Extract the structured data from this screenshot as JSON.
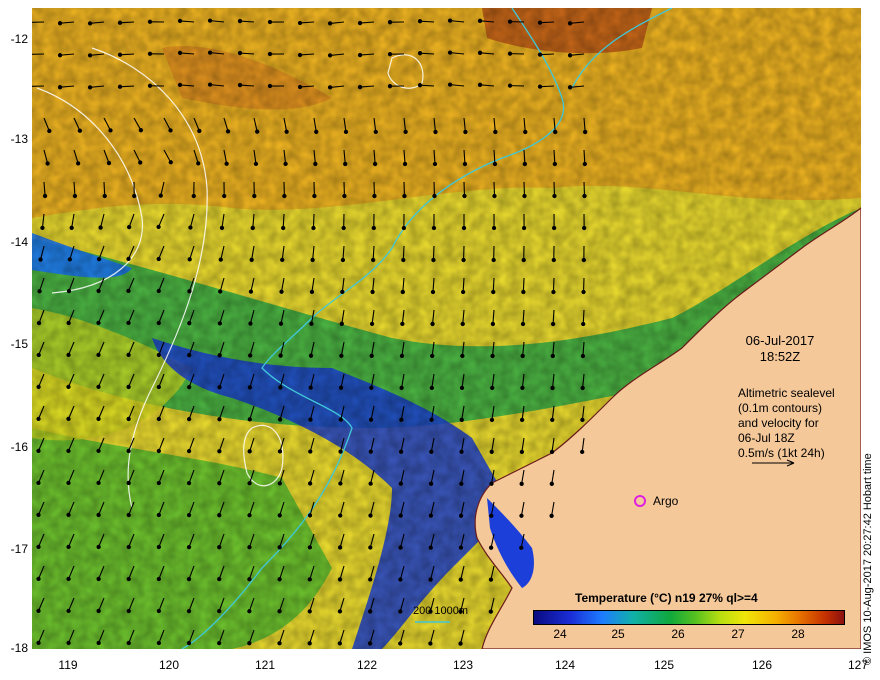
{
  "map": {
    "lat_labels": [
      "-12",
      "-13",
      "-14",
      "-15",
      "-16",
      "-17",
      "-18"
    ],
    "lon_labels": [
      "119",
      "120",
      "121",
      "122",
      "123",
      "124",
      "125",
      "126",
      "127"
    ],
    "date": "06-Jul-2017",
    "time": "18:52Z",
    "legend_lines": [
      "Altimetric sealevel",
      "(0.1m contours)",
      "and velocity for",
      "06-Jul 18Z",
      "0.5m/s (1kt 24h)"
    ],
    "argo_label": "Argo",
    "depth_contours_label": "200  1000m",
    "colorbar": {
      "title": "Temperature (°C) n19 27% ql>=4",
      "ticks": [
        "24",
        "25",
        "26",
        "27",
        "28"
      ]
    },
    "credit": "© IMOS 10-Aug-2017 20:27:42 Hobart time",
    "colors": {
      "land": "#f5c89a",
      "cold": "#1b2fd8",
      "warm": "#f0b020",
      "depth_contour": "#40c8d8",
      "argo_marker": "#e020e0"
    }
  }
}
